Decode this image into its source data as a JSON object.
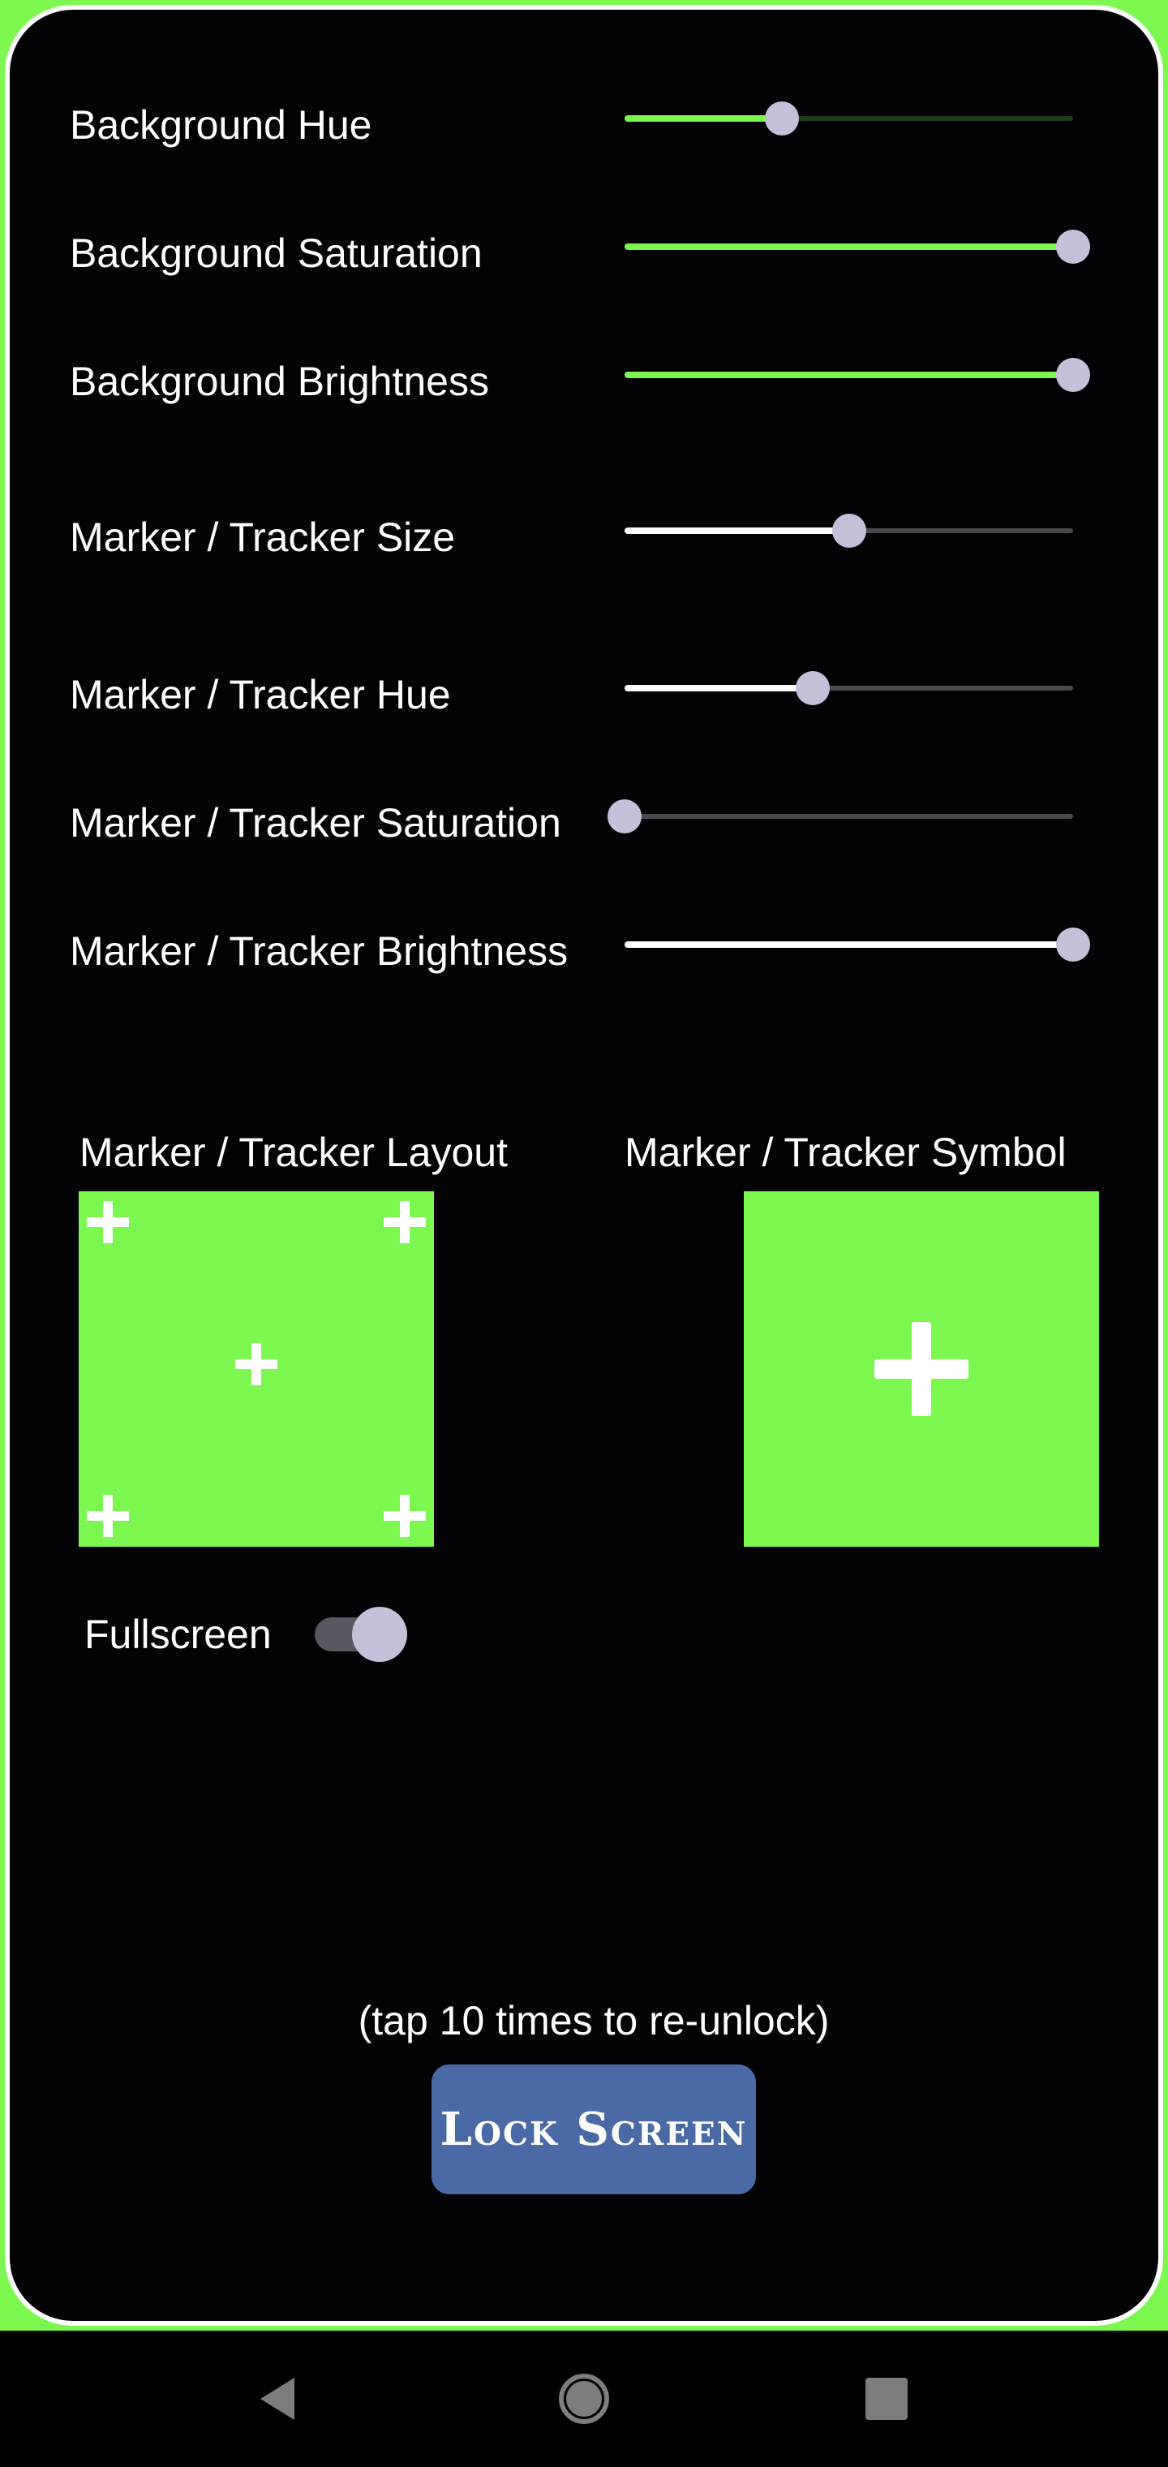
{
  "sliders": [
    {
      "label": "Background Hue",
      "value": 0.35,
      "group": "background"
    },
    {
      "label": "Background Saturation",
      "value": 1.0,
      "group": "background"
    },
    {
      "label": "Background Brightness",
      "value": 1.0,
      "group": "background"
    },
    {
      "label": "Marker / Tracker Size",
      "value": 0.5,
      "group": "marker"
    },
    {
      "label": "Marker / Tracker Hue",
      "value": 0.42,
      "group": "marker"
    },
    {
      "label": "Marker / Tracker Saturation",
      "value": 0.0,
      "group": "marker"
    },
    {
      "label": "Marker / Tracker Brightness",
      "value": 1.0,
      "group": "marker"
    }
  ],
  "layout_picker": {
    "title": "Marker / Tracker Layout",
    "icon": "five-plus-layout-icon"
  },
  "symbol_picker": {
    "title": "Marker / Tracker Symbol",
    "icon": "plus-symbol-icon"
  },
  "fullscreen": {
    "label": "Fullscreen",
    "on": true
  },
  "lock": {
    "hint": "(tap 10 times to re-unlock)",
    "button_label": "Lock Screen"
  },
  "colors": {
    "accent_green": "#7cf74f",
    "background": "#030305",
    "thumb": "#c5bfd9",
    "button": "#4a6aa5"
  },
  "navbar": {
    "back_icon": "back-triangle-icon",
    "home_icon": "home-circle-icon",
    "recents_icon": "recents-square-icon"
  }
}
